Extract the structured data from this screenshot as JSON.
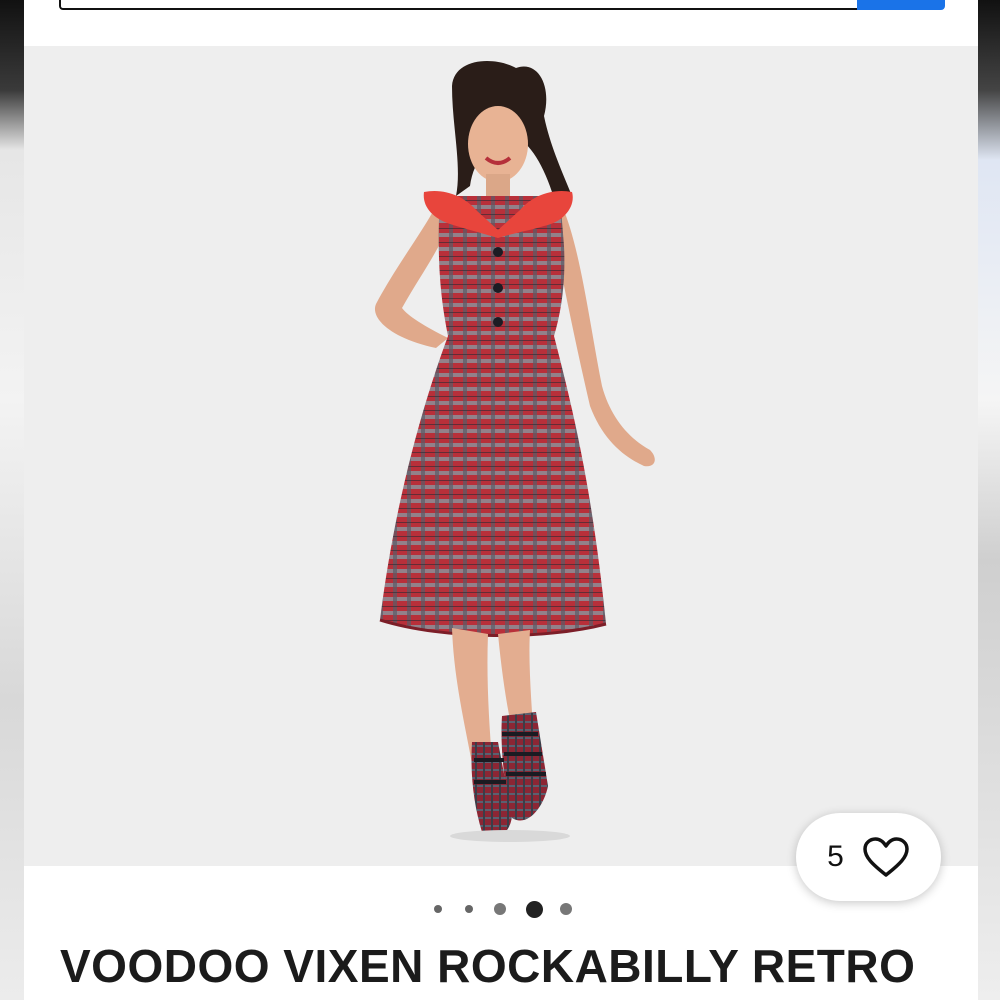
{
  "listing": {
    "likes_count": "5",
    "title": "VOODOO VIXEN ROCKABILLY RETRO",
    "carousel": {
      "total_images": 5,
      "active_index": 3
    }
  },
  "icons": {
    "like": "heart-outline-icon"
  },
  "colors": {
    "search_button": "#1a73e8",
    "image_background": "#eeeeee",
    "dress_red": "#b8303a",
    "collar_red": "#e8453c",
    "title_text": "#1b1b1b"
  }
}
